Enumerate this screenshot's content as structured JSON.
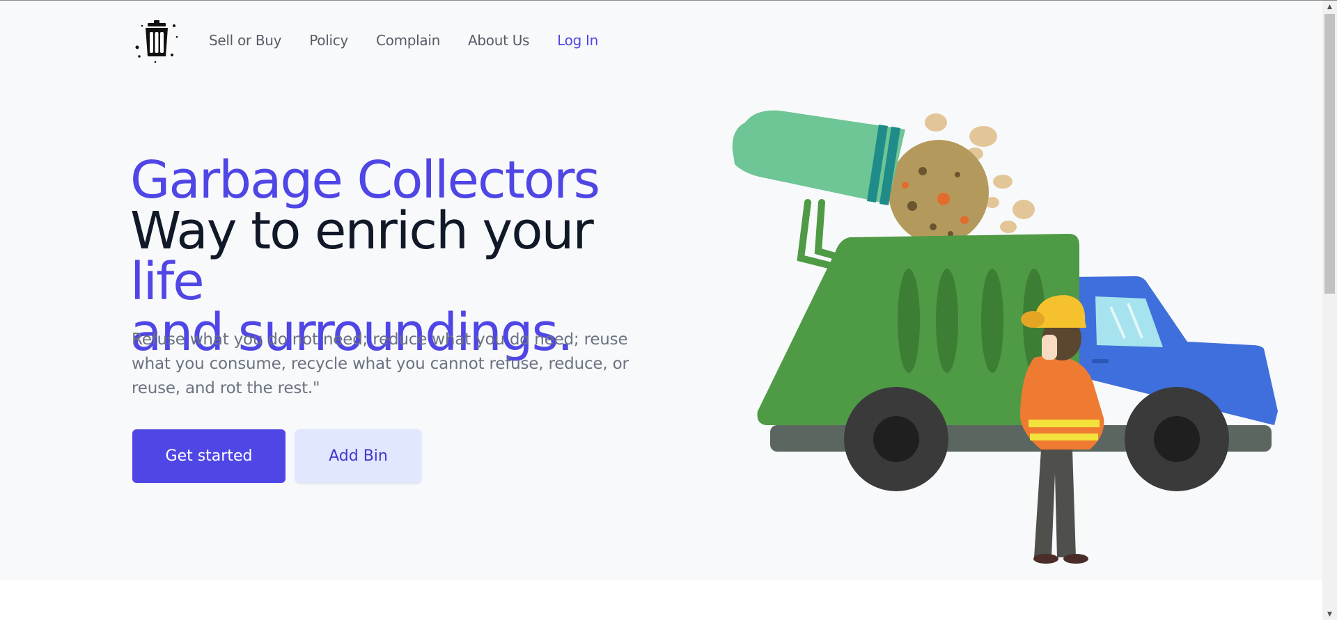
{
  "nav": {
    "logo_icon": "trash-bin-icon",
    "links": [
      {
        "label": "Sell or Buy"
      },
      {
        "label": "Policy"
      },
      {
        "label": "Complain"
      },
      {
        "label": "About Us"
      }
    ],
    "login_label": "Log In"
  },
  "hero": {
    "title_line1": "Garbage Collectors",
    "title_line2_dark": "Way to enrich your",
    "title_line2_accent": "life",
    "title_line3": "and surroundings.",
    "subtext": "Refuse what you do not need; reduce what you do need; reuse what you consume, recycle what you cannot refuse, reduce, or reuse, and rot the rest.\"",
    "primary_button": "Get started",
    "secondary_button": "Add Bin",
    "illustration_icon": "garbage-truck-illustration-icon"
  },
  "colors": {
    "accent": "#4f46e5",
    "dark_text": "#111827",
    "muted_text": "#6b7280",
    "hero_bg": "#f8f9fb",
    "secondary_button_bg": "#e0e7ff"
  },
  "scrollbar": {
    "up_icon": "scroll-up-arrow-icon",
    "down_icon": "scroll-down-arrow-icon"
  }
}
